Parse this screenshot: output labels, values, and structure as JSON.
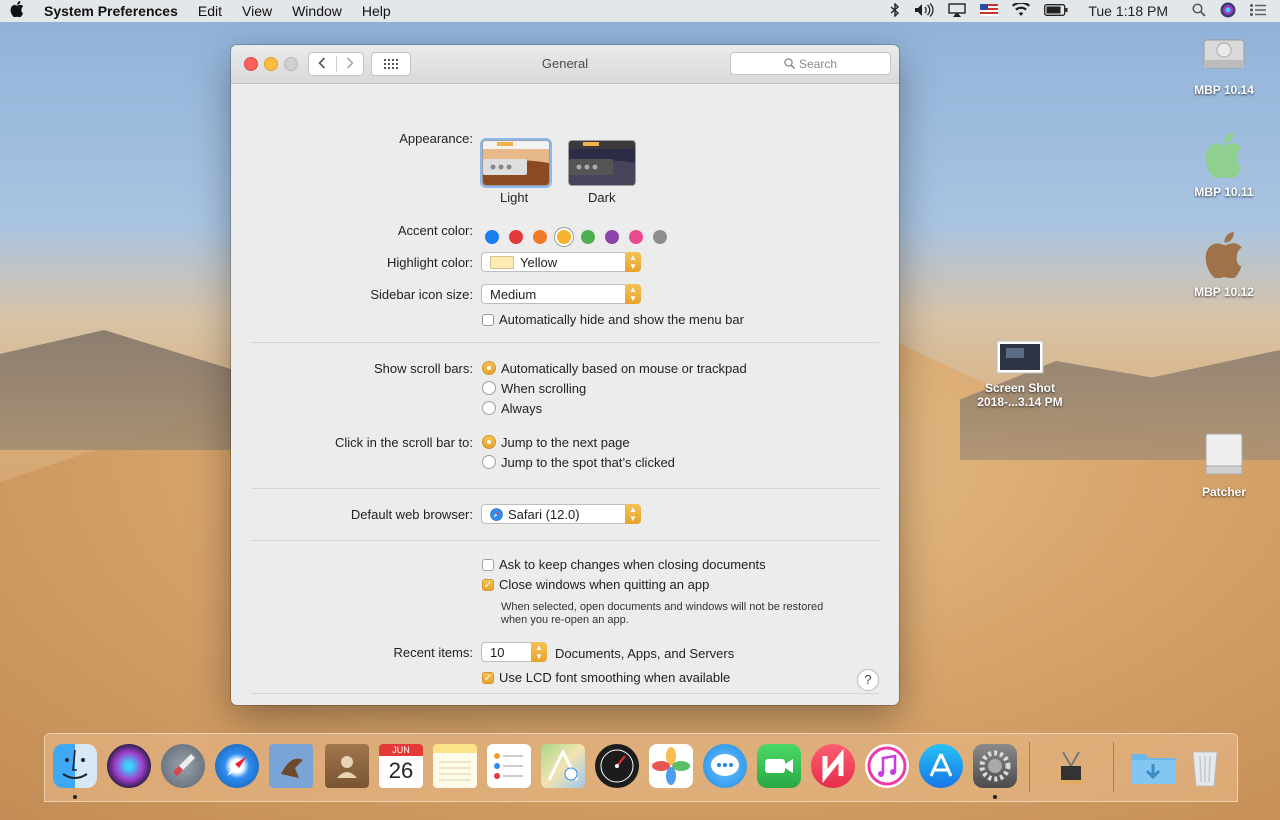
{
  "menubar": {
    "apple": "",
    "app_name": "System Preferences",
    "menus": [
      "Edit",
      "View",
      "Window",
      "Help"
    ],
    "clock": "Tue 1:18 PM"
  },
  "window": {
    "title": "General",
    "search_placeholder": "Search"
  },
  "appearance": {
    "label": "Appearance:",
    "options": [
      "Light",
      "Dark"
    ],
    "selected": "Light"
  },
  "accent": {
    "label": "Accent color:",
    "colors": [
      "#1a7ef0",
      "#e1393c",
      "#f07a2a",
      "#f6b32b",
      "#4caf50",
      "#8e44ad",
      "#ec4a8e",
      "#8e8e8e"
    ],
    "selected_index": 3
  },
  "highlight": {
    "label": "Highlight color:",
    "value": "Yellow",
    "swatch": "#fde9b2"
  },
  "sidebar_size": {
    "label": "Sidebar icon size:",
    "value": "Medium"
  },
  "menubar_hide": {
    "label": "Automatically hide and show the menu bar",
    "checked": false
  },
  "scroll_bars": {
    "label": "Show scroll bars:",
    "options": [
      "Automatically based on mouse or trackpad",
      "When scrolling",
      "Always"
    ],
    "selected_index": 0
  },
  "click_scroll": {
    "label": "Click in the scroll bar to:",
    "options": [
      "Jump to the next page",
      "Jump to the spot that’s clicked"
    ],
    "selected_index": 0
  },
  "browser": {
    "label": "Default web browser:",
    "value": "Safari (12.0)"
  },
  "ask_keep": {
    "label": "Ask to keep changes when closing documents",
    "checked": false
  },
  "close_windows": {
    "label": "Close windows when quitting an app",
    "checked": true,
    "note_line1": "When selected, open documents and windows will not be restored",
    "note_line2": "when you re-open an app."
  },
  "recent": {
    "label": "Recent items:",
    "value": "10",
    "suffix": "Documents, Apps, and Servers"
  },
  "lcd": {
    "label": "Use LCD font smoothing when available",
    "checked": true
  },
  "help": "?",
  "desktop": [
    {
      "name": "MBP 10.14"
    },
    {
      "name": "MBP 10.11"
    },
    {
      "name": "MBP 10.12"
    },
    {
      "name_line1": "Screen Shot",
      "name_line2": "2018-...3.14 PM"
    },
    {
      "name": "Patcher"
    }
  ],
  "calendar": {
    "month": "JUN",
    "day": "26"
  }
}
